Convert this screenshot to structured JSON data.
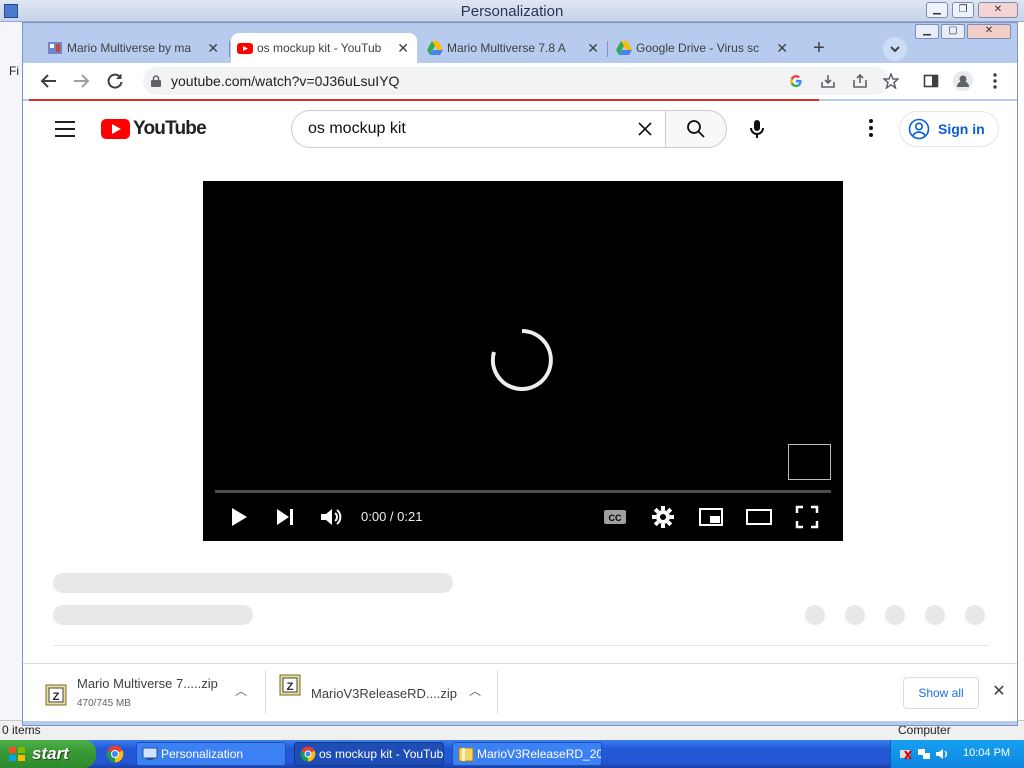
{
  "background": {
    "title": "Personalization",
    "menu_stub": "Fi",
    "status_left": "0 items",
    "status_right": "Computer"
  },
  "browser": {
    "tabs": [
      {
        "title": "Mario Multiverse by ma",
        "icon": "mario-icon",
        "active": false
      },
      {
        "title": "os mockup kit - YouTub",
        "icon": "youtube-icon",
        "active": true
      },
      {
        "title": "Mario Multiverse 7.8 A",
        "icon": "google-drive-icon",
        "active": false
      },
      {
        "title": "Google Drive - Virus sc",
        "icon": "google-drive-icon",
        "active": false
      }
    ],
    "new_tab_label": "+",
    "url": "youtube.com/watch?v=0J36uLsuIYQ",
    "accent_color": "#d93025"
  },
  "youtube": {
    "logo_text": "YouTube",
    "search_query": "os mockup kit",
    "sign_in_label": "Sign in",
    "player": {
      "current_time": "0:00",
      "separator": " / ",
      "duration": "0:21",
      "time_display": "0:00 / 0:21"
    }
  },
  "downloads": {
    "items": [
      {
        "name": "Mario Multiverse 7.....zip",
        "size": "470/745 MB"
      },
      {
        "name": "MarioV3ReleaseRD....zip",
        "size": ""
      }
    ],
    "show_all_label": "Show all"
  },
  "taskbar": {
    "start_label": "start",
    "buttons": [
      {
        "label": "Personalization",
        "icon": "control-panel-icon"
      },
      {
        "label": "os mockup kit - YouTub...",
        "icon": "chrome-icon"
      },
      {
        "label": "MarioV3ReleaseRD_20...",
        "icon": "folder-icon"
      }
    ],
    "clock": "10:04 PM"
  }
}
